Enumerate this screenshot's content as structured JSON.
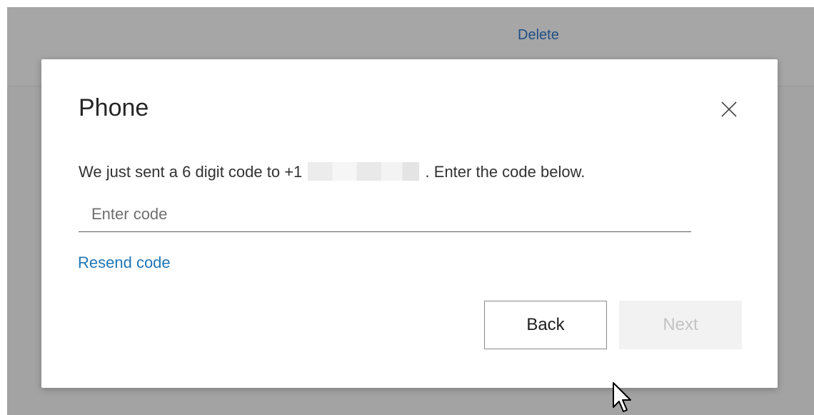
{
  "background": {
    "link_label": "Delete"
  },
  "dialog": {
    "title": "Phone",
    "close_icon": "close-icon",
    "message_before": "We just sent a 6 digit code to +1",
    "message_after": ". Enter the code below.",
    "code_input": {
      "value": "",
      "placeholder": "Enter code"
    },
    "resend_label": "Resend code",
    "back_label": "Back",
    "next_label": "Next"
  },
  "colors": {
    "overlay": "#a3a3a3",
    "link": "#1f76b4",
    "disabled_button_bg": "#f2f2f2",
    "disabled_button_text": "#c3c3c3"
  }
}
